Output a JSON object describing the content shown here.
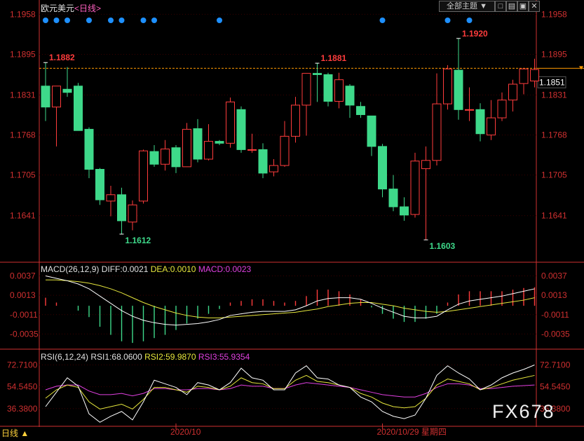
{
  "header": {
    "symbol": "欧元美元",
    "period": "<日线>",
    "theme_button": "全部主题",
    "ctrl_buttons": [
      "□",
      "▤",
      "▣",
      "✕"
    ]
  },
  "colors": {
    "up": "#ff3c3c",
    "down": "#3ed98a",
    "diff": "#ffffff",
    "dea": "#e6e63c",
    "macd": "#e040e0",
    "rsi1": "#ffffff",
    "rsi2": "#e6e63c",
    "rsi3": "#e040e0",
    "axis": "#d03030",
    "ref": "#ff9900",
    "dots": "#1e90ff"
  },
  "price_axis": {
    "labels": [
      "1.1958",
      "1.1895",
      "1.1831",
      "1.1768",
      "1.1705",
      "1.1641"
    ],
    "values": [
      1.1958,
      1.1895,
      1.1831,
      1.1768,
      1.1705,
      1.1641
    ],
    "range": [
      1.157,
      1.1965
    ]
  },
  "reference_line": {
    "value": 1.1873
  },
  "last_price": {
    "value": 1.1851,
    "label": "1.1851"
  },
  "annotations": [
    {
      "label": "1.1882",
      "index": 0,
      "value": 1.1882,
      "pos": "high",
      "color": "#ff3c3c"
    },
    {
      "label": "1.1612",
      "index": 7,
      "value": 1.1612,
      "pos": "low",
      "color": "#3ed98a"
    },
    {
      "label": "1.1881",
      "index": 25,
      "value": 1.1881,
      "pos": "high",
      "color": "#ff3c3c"
    },
    {
      "label": "1.1603",
      "index": 35,
      "value": 1.1603,
      "pos": "low",
      "color": "#3ed98a"
    },
    {
      "label": "1.1920",
      "index": 38,
      "value": 1.192,
      "pos": "high",
      "color": "#ff3c3c"
    }
  ],
  "event_dot_indices": [
    0,
    1,
    2,
    4,
    6,
    7,
    9,
    10,
    16,
    31,
    37,
    39
  ],
  "macd": {
    "title": "MACD(26,12,9)",
    "diff_label": "DIFF:0.0021",
    "dea_label": "DEA:0.0010",
    "macd_label": "MACD:0.0023",
    "axis_labels": [
      "0.0037",
      "0.0013",
      "-0.0011",
      "-0.0035"
    ],
    "axis_values": [
      0.0037,
      0.0013,
      -0.0011,
      -0.0035
    ],
    "range": [
      -0.0052,
      0.0047
    ]
  },
  "rsi": {
    "title": "RSI(6,12,24)",
    "rsi1_label": "RSI1:68.0600",
    "rsi2_label": "RSI2:59.9870",
    "rsi3_label": "RSI3:55.9354",
    "axis_labels": [
      "72.7100",
      "54.5450",
      "36.3800"
    ],
    "axis_values": [
      72.71,
      54.545,
      36.38
    ],
    "range": [
      24,
      80
    ]
  },
  "bottom_bar": {
    "period_label": "日线",
    "dates": [
      {
        "label": "2020/10",
        "index": 12
      },
      {
        "label": "2020/10/29 星期四",
        "index": 31
      }
    ]
  },
  "watermark": "FX678",
  "chart_data": {
    "type": "candlestick",
    "title": "欧元美元<日线>",
    "candles": [
      {
        "o": 1.1845,
        "h": 1.1882,
        "l": 1.179,
        "c": 1.1812
      },
      {
        "o": 1.1812,
        "h": 1.1845,
        "l": 1.175,
        "c": 1.1845
      },
      {
        "o": 1.184,
        "h": 1.1875,
        "l": 1.1828,
        "c": 1.1835
      },
      {
        "o": 1.1845,
        "h": 1.185,
        "l": 1.1775,
        "c": 1.1775
      },
      {
        "o": 1.1777,
        "h": 1.178,
        "l": 1.17,
        "c": 1.1714
      },
      {
        "o": 1.1714,
        "h": 1.1716,
        "l": 1.1658,
        "c": 1.1666
      },
      {
        "o": 1.1664,
        "h": 1.1688,
        "l": 1.164,
        "c": 1.1674
      },
      {
        "o": 1.1674,
        "h": 1.1685,
        "l": 1.1612,
        "c": 1.1633
      },
      {
        "o": 1.1631,
        "h": 1.1665,
        "l": 1.1618,
        "c": 1.1658
      },
      {
        "o": 1.1664,
        "h": 1.1745,
        "l": 1.166,
        "c": 1.1743
      },
      {
        "o": 1.1742,
        "h": 1.1752,
        "l": 1.1718,
        "c": 1.1722
      },
      {
        "o": 1.1722,
        "h": 1.176,
        "l": 1.1712,
        "c": 1.1746
      },
      {
        "o": 1.1748,
        "h": 1.1752,
        "l": 1.1708,
        "c": 1.1718
      },
      {
        "o": 1.1718,
        "h": 1.1787,
        "l": 1.1718,
        "c": 1.1777
      },
      {
        "o": 1.1778,
        "h": 1.1793,
        "l": 1.1725,
        "c": 1.173
      },
      {
        "o": 1.173,
        "h": 1.1785,
        "l": 1.1728,
        "c": 1.1758
      },
      {
        "o": 1.1758,
        "h": 1.176,
        "l": 1.1752,
        "c": 1.1755
      },
      {
        "o": 1.1755,
        "h": 1.1827,
        "l": 1.1748,
        "c": 1.182
      },
      {
        "o": 1.1808,
        "h": 1.1813,
        "l": 1.174,
        "c": 1.1745
      },
      {
        "o": 1.1745,
        "h": 1.177,
        "l": 1.174,
        "c": 1.1745
      },
      {
        "o": 1.1745,
        "h": 1.1755,
        "l": 1.17,
        "c": 1.1708
      },
      {
        "o": 1.171,
        "h": 1.173,
        "l": 1.1703,
        "c": 1.172
      },
      {
        "o": 1.172,
        "h": 1.179,
        "l": 1.1718,
        "c": 1.1766
      },
      {
        "o": 1.1766,
        "h": 1.1828,
        "l": 1.1756,
        "c": 1.1815
      },
      {
        "o": 1.1815,
        "h": 1.1845,
        "l": 1.1767,
        "c": 1.1865
      },
      {
        "o": 1.1865,
        "h": 1.1881,
        "l": 1.182,
        "c": 1.1863
      },
      {
        "o": 1.1863,
        "h": 1.1866,
        "l": 1.1813,
        "c": 1.1821
      },
      {
        "o": 1.1821,
        "h": 1.1866,
        "l": 1.181,
        "c": 1.1855
      },
      {
        "o": 1.1845,
        "h": 1.1848,
        "l": 1.1795,
        "c": 1.1815
      },
      {
        "o": 1.1813,
        "h": 1.182,
        "l": 1.1795,
        "c": 1.18
      },
      {
        "o": 1.1798,
        "h": 1.1798,
        "l": 1.1735,
        "c": 1.175
      },
      {
        "o": 1.175,
        "h": 1.1754,
        "l": 1.167,
        "c": 1.1683
      },
      {
        "o": 1.1683,
        "h": 1.1705,
        "l": 1.1648,
        "c": 1.1655
      },
      {
        "o": 1.1655,
        "h": 1.167,
        "l": 1.1633,
        "c": 1.1642
      },
      {
        "o": 1.1643,
        "h": 1.174,
        "l": 1.1638,
        "c": 1.1727
      },
      {
        "o": 1.1715,
        "h": 1.175,
        "l": 1.1603,
        "c": 1.1728
      },
      {
        "o": 1.1728,
        "h": 1.1865,
        "l": 1.172,
        "c": 1.1817
      },
      {
        "o": 1.1817,
        "h": 1.1878,
        "l": 1.1808,
        "c": 1.1872
      },
      {
        "o": 1.187,
        "h": 1.192,
        "l": 1.1792,
        "c": 1.1808
      },
      {
        "o": 1.1807,
        "h": 1.1843,
        "l": 1.179,
        "c": 1.1808
      },
      {
        "o": 1.1808,
        "h": 1.1818,
        "l": 1.1758,
        "c": 1.177
      },
      {
        "o": 1.1768,
        "h": 1.1823,
        "l": 1.176,
        "c": 1.1795
      },
      {
        "o": 1.1795,
        "h": 1.1835,
        "l": 1.179,
        "c": 1.1823
      },
      {
        "o": 1.1823,
        "h": 1.1855,
        "l": 1.1805,
        "c": 1.1848
      },
      {
        "o": 1.1849,
        "h": 1.1873,
        "l": 1.1832,
        "c": 1.1872
      },
      {
        "o": 1.1853,
        "h": 1.1888,
        "l": 1.1843,
        "c": 1.1871
      }
    ],
    "macd_series": {
      "diff": [
        0.0037,
        0.0034,
        0.0031,
        0.0027,
        0.0021,
        0.0012,
        0.0003,
        -0.0006,
        -0.0013,
        -0.0018,
        -0.0021,
        -0.0023,
        -0.0024,
        -0.0023,
        -0.0022,
        -0.002,
        -0.0017,
        -0.0012,
        -0.001,
        -0.0008,
        -0.0007,
        -0.0007,
        -0.0007,
        -0.0005,
        0.0,
        0.0006,
        0.0009,
        0.001,
        0.001,
        0.0008,
        0.0003,
        -0.0003,
        -0.0008,
        -0.0013,
        -0.0015,
        -0.0015,
        -0.0013,
        -0.0005,
        0.0002,
        0.0006,
        0.0008,
        0.001,
        0.0012,
        0.0015,
        0.0018,
        0.0021
      ],
      "dea": [
        0.0032,
        0.0032,
        0.0031,
        0.003,
        0.0028,
        0.0025,
        0.0021,
        0.0016,
        0.001,
        0.0004,
        -0.0001,
        -0.0005,
        -0.0009,
        -0.0012,
        -0.0014,
        -0.0015,
        -0.0015,
        -0.0014,
        -0.0013,
        -0.0012,
        -0.0011,
        -0.001,
        -0.0009,
        -0.0008,
        -0.0006,
        -0.0004,
        -0.0001,
        0.0001,
        0.0003,
        0.0004,
        0.0004,
        0.0002,
        0.0,
        -0.0003,
        -0.0005,
        -0.0007,
        -0.0008,
        -0.0007,
        -0.0005,
        -0.0003,
        -0.0001,
        0.0001,
        0.0003,
        0.0005,
        0.0007,
        0.001
      ],
      "macd": [
        0.001,
        0.0004,
        0.0,
        -0.0006,
        -0.0014,
        -0.0026,
        -0.0036,
        -0.0044,
        -0.0046,
        -0.0044,
        -0.004,
        -0.0036,
        -0.003,
        -0.0022,
        -0.0016,
        -0.001,
        -0.0004,
        0.0004,
        0.0006,
        0.0008,
        0.0008,
        0.0006,
        0.0004,
        0.0006,
        0.0012,
        0.002,
        0.002,
        0.0018,
        0.0014,
        0.0008,
        -0.0002,
        -0.001,
        -0.0016,
        -0.002,
        -0.002,
        -0.0016,
        -0.001,
        0.0004,
        0.0014,
        0.0018,
        0.0018,
        0.0018,
        0.0018,
        0.002,
        0.0022,
        0.0023
      ]
    },
    "rsi_series": {
      "rsi1": [
        38,
        50,
        62,
        55,
        32,
        25,
        30,
        34,
        27,
        42,
        60,
        57,
        54,
        48,
        58,
        56,
        52,
        58,
        70,
        62,
        60,
        52,
        52,
        66,
        72,
        62,
        61,
        56,
        54,
        46,
        42,
        34,
        30,
        28,
        31,
        45,
        64,
        72,
        66,
        61,
        52,
        56,
        62,
        66,
        69,
        72.71
      ],
      "rsi2": [
        45,
        52,
        56,
        54,
        42,
        36,
        38,
        40,
        36,
        44,
        54,
        54,
        52,
        50,
        55,
        54,
        52,
        55,
        62,
        58,
        57,
        53,
        53,
        60,
        64,
        59,
        58,
        56,
        54,
        49,
        46,
        41,
        38,
        37,
        38,
        45,
        56,
        61,
        59,
        57,
        52,
        54,
        57,
        60,
        62,
        64
      ],
      "rsi3": [
        52,
        55,
        56,
        56,
        51,
        48,
        48,
        49,
        47,
        49,
        53,
        53,
        52,
        52,
        53,
        53,
        52,
        53,
        56,
        55,
        55,
        53,
        53,
        56,
        58,
        57,
        56,
        55,
        54,
        52,
        50,
        48,
        47,
        46,
        46,
        49,
        54,
        57,
        57,
        56,
        53,
        53,
        54,
        55,
        55.5,
        56
      ]
    }
  }
}
